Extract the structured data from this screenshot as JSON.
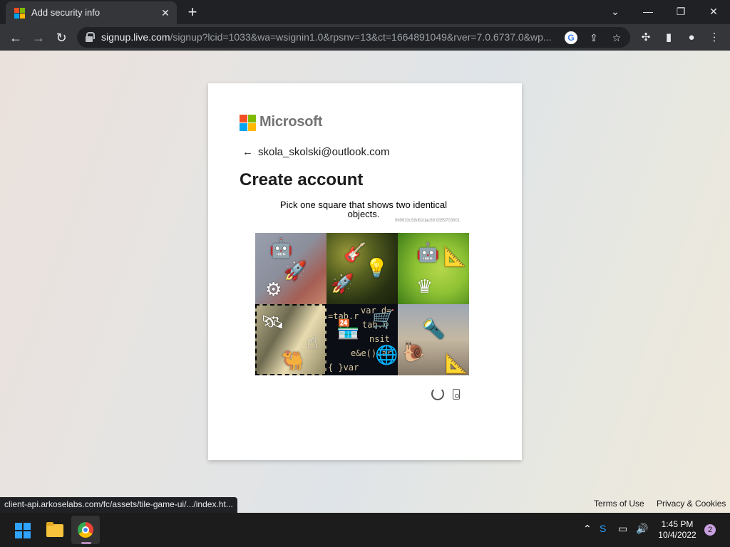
{
  "browser": {
    "tab_title": "Add security info",
    "tab_close": "✕",
    "new_tab": "+",
    "url_host": "signup.live.com",
    "url_path": "/signup?lcid=1033&wa=wsignin1.0&rpsnv=13&ct=1664891049&rver=7.0.6737.0&wp...",
    "status_url": "client-api.arkoselabs.com/fc/assets/tile-game-ui/.../index.ht...",
    "colors": {
      "ms_red": "#f25022",
      "ms_green": "#7fba00",
      "ms_blue": "#00a4ef",
      "ms_yellow": "#ffb900"
    }
  },
  "signup": {
    "brand": "Microsoft",
    "identity": "skola_skolski@outlook.com",
    "heading": "Create account",
    "prompt": "Pick one square that shows two identical objects.",
    "session_id": "969633c58d62dac89.9359703601",
    "tiles": [
      {
        "icons": [
          "robot-icon",
          "rocket-icon",
          "gear-icon"
        ]
      },
      {
        "icons": [
          "guitar-icon",
          "rocket-icon",
          "bulb-icon"
        ]
      },
      {
        "icons": [
          "robot-icon",
          "ruler-icon",
          "crown-icon"
        ]
      },
      {
        "icons": [
          "satellite-icon",
          "camel-icon",
          "hand-icon"
        ]
      },
      {
        "icons": [
          "house-icon",
          "globe-icon",
          "cart-icon"
        ]
      },
      {
        "icons": [
          "flashlight-icon",
          "snail-icon",
          "ruler-icon"
        ]
      }
    ],
    "selected_tile": 4,
    "code_lines": [
      "var d=",
      "tab.n",
      "nsit",
      "=tab.r",
      "e&e()var",
      "{ }var"
    ]
  },
  "footer": {
    "terms": "Terms of Use",
    "privacy": "Privacy & Cookies"
  },
  "taskbar": {
    "time": "1:45 PM",
    "date": "10/4/2022",
    "notifications": "2"
  }
}
